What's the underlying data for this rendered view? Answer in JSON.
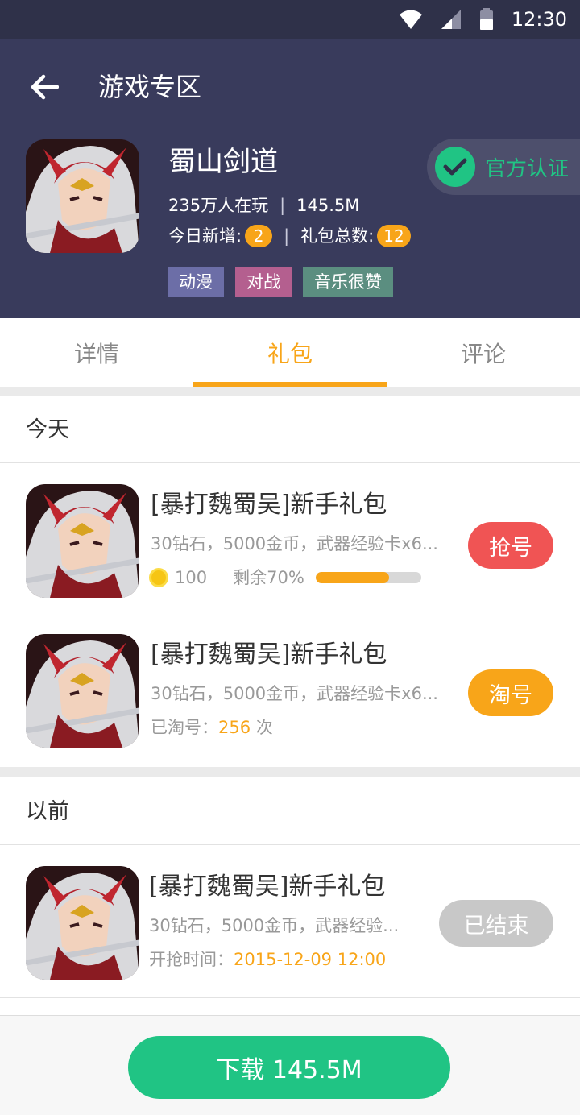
{
  "status_bar": {
    "time": "12:30",
    "icons": [
      "wifi-icon",
      "signal-icon",
      "battery-icon"
    ]
  },
  "header": {
    "title": "游戏专区",
    "game": {
      "name": "蜀山剑道",
      "players": "235万人在玩",
      "stat_sep": "|",
      "size": "145.5M",
      "new_today_label": "今日新增:",
      "new_today": "2",
      "gift_total_label": "礼包总数:",
      "gift_total": "12",
      "certified": "官方认证",
      "tags": [
        "动漫",
        "对战",
        "音乐很赞"
      ]
    }
  },
  "tabs": [
    {
      "label": "详情",
      "active": false
    },
    {
      "label": "礼包",
      "active": true
    },
    {
      "label": "评论",
      "active": false
    }
  ],
  "sections": {
    "today": {
      "title": "今天",
      "items": [
        {
          "title": "[暴打魏蜀吴]新手礼包",
          "desc": "30钻石，5000金币，武器经验卡x6...",
          "coins": "100",
          "remaining_label": "剩余70%",
          "remaining": 0.7,
          "button": "抢号"
        },
        {
          "title": "[暴打魏蜀吴]新手礼包",
          "desc": "30钻石，5000金币，武器经验卡x6...",
          "taken_label": "已淘号：",
          "taken_count": "256",
          "taken_unit": " 次",
          "button": "淘号"
        }
      ]
    },
    "before": {
      "title": "以前",
      "items": [
        {
          "title": "[暴打魏蜀吴]新手礼包",
          "desc": "30钻石，5000金币，武器经验...",
          "time_label": "开抢时间：",
          "time": "2015-12-09 12:00",
          "button": "已结束"
        }
      ]
    }
  },
  "download": {
    "label": "下载 145.5M"
  },
  "colors": {
    "header_bg": "#393b5c",
    "accent": "#f8a519",
    "green": "#20c484",
    "red": "#f05454"
  }
}
